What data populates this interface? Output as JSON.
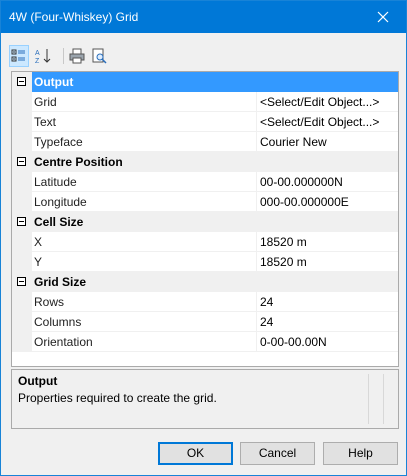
{
  "window": {
    "title": "4W (Four-Whiskey) Grid"
  },
  "toolbar": {
    "buttons": [
      {
        "name": "categorized-view-icon"
      },
      {
        "name": "alphabetical-sort-icon"
      },
      {
        "name": "print-icon"
      },
      {
        "name": "print-preview-icon"
      }
    ]
  },
  "grid": {
    "categories": [
      {
        "label": "Output",
        "selected": true,
        "properties": [
          {
            "name": "Grid",
            "value": "<Select/Edit Object...>"
          },
          {
            "name": "Text",
            "value": "<Select/Edit Object...>"
          },
          {
            "name": "Typeface",
            "value": "Courier New"
          }
        ]
      },
      {
        "label": "Centre Position",
        "properties": [
          {
            "name": "Latitude",
            "value": "00-00.000000N"
          },
          {
            "name": "Longitude",
            "value": "000-00.000000E"
          }
        ]
      },
      {
        "label": "Cell Size",
        "properties": [
          {
            "name": "X",
            "value": "18520 m"
          },
          {
            "name": "Y",
            "value": "18520 m"
          }
        ]
      },
      {
        "label": "Grid Size",
        "properties": [
          {
            "name": "Rows",
            "value": "24"
          },
          {
            "name": "Columns",
            "value": "24"
          },
          {
            "name": "Orientation",
            "value": "0-00-00.00N"
          }
        ]
      }
    ]
  },
  "description": {
    "title": "Output",
    "text": "Properties required to create the grid."
  },
  "buttons": {
    "ok": "OK",
    "cancel": "Cancel",
    "help": "Help"
  }
}
